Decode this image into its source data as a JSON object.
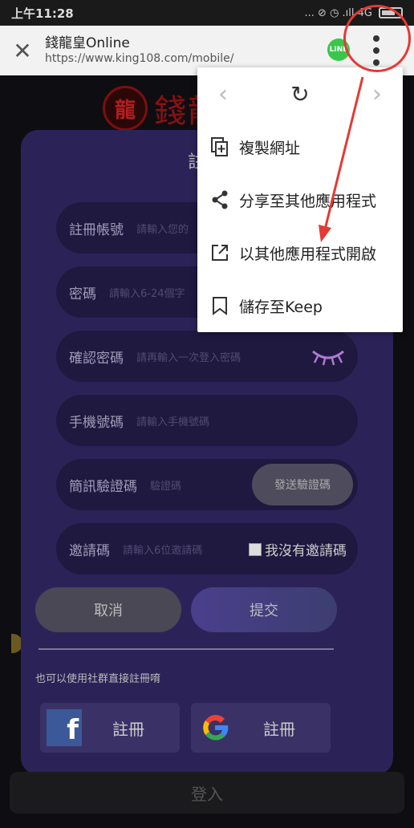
{
  "status_bar": {
    "time": "上午11:28",
    "indicators": "... ⊘ ◷ .ıll 4G"
  },
  "url_bar": {
    "close_glyph": "✕",
    "title": "錢龍皇Online",
    "url": "https://www.king108.com/mobile/",
    "line_badge": "LINE"
  },
  "brand": {
    "emblem": "龍",
    "name": "錢龍"
  },
  "form": {
    "title": "註",
    "fields": [
      {
        "label": "註冊帳號",
        "placeholder": "請輸入您的"
      },
      {
        "label": "密碼",
        "placeholder": "請輸入6-24個字"
      },
      {
        "label": "確認密碼",
        "placeholder": "請再輸入一次登入密碼"
      },
      {
        "label": "手機號碼",
        "placeholder": "請輸入手機號碼"
      },
      {
        "label": "簡訊驗證碼",
        "placeholder": "驗證碼"
      },
      {
        "label": "邀請碼",
        "placeholder": "請輸入6位邀請碼"
      }
    ],
    "sms_button": "發送驗證碼",
    "no_invite_label": "我沒有邀請碼",
    "cancel": "取消",
    "submit": "提交",
    "social_hint": "也可以使用社群直接註冊唷",
    "facebook_register": "註冊",
    "google_register": "註冊",
    "login": "登入"
  },
  "menu": {
    "back_glyph": "‹",
    "forward_glyph": "›",
    "reload_glyph": "↻",
    "items": [
      {
        "label": "複製網址",
        "icon": "copy-add-icon"
      },
      {
        "label": "分享至其他應用程式",
        "icon": "share-icon"
      },
      {
        "label": "以其他應用程式開啟",
        "icon": "open-external-icon"
      },
      {
        "label": "儲存至Keep",
        "icon": "bookmark-icon"
      }
    ]
  },
  "colors": {
    "annotation_red": "#e53935",
    "panel": "#2b2358",
    "menu_bg": "#ffffff"
  }
}
